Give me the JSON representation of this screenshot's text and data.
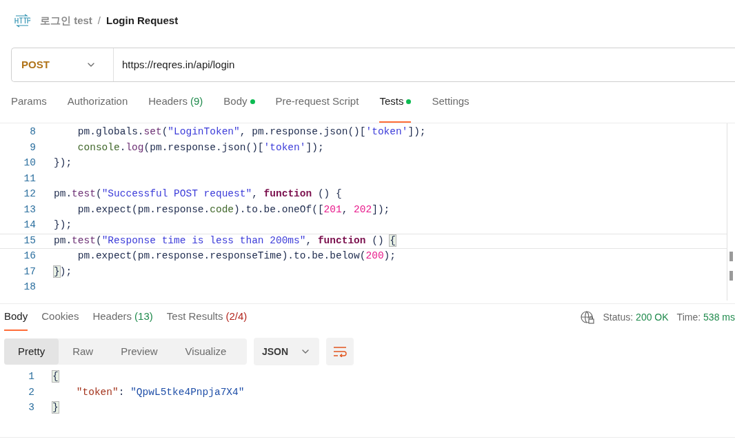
{
  "breadcrumb": {
    "collection": "로그인 test",
    "separator": "/",
    "request": "Login Request"
  },
  "request": {
    "method": "POST",
    "url": "https://reqres.in/api/login"
  },
  "request_tabs": [
    {
      "label": "Params",
      "selected": false
    },
    {
      "label": "Authorization",
      "selected": false
    },
    {
      "label": "Headers",
      "count": "(9)",
      "selected": false
    },
    {
      "label": "Body",
      "dot": true,
      "selected": false
    },
    {
      "label": "Pre-request Script",
      "selected": false
    },
    {
      "label": "Tests",
      "dot": true,
      "selected": true
    },
    {
      "label": "Settings",
      "selected": false
    }
  ],
  "editor": {
    "lines": [
      {
        "number": "8",
        "tokens": [
          {
            "text": "    pm.",
            "kind": "plain"
          },
          {
            "text": "globals",
            "kind": "plain"
          },
          {
            "text": ".",
            "kind": "plain"
          },
          {
            "text": "set",
            "kind": "method"
          },
          {
            "text": "(",
            "kind": "plain"
          },
          {
            "text": "\"LoginToken\"",
            "kind": "string"
          },
          {
            "text": ", pm.response.json()[",
            "kind": "plain"
          },
          {
            "text": "'token'",
            "kind": "string"
          },
          {
            "text": "]);",
            "kind": "plain"
          }
        ]
      },
      {
        "number": "9",
        "tokens": [
          {
            "text": "    console",
            "kind": "builtin"
          },
          {
            "text": ".",
            "kind": "plain"
          },
          {
            "text": "log",
            "kind": "method"
          },
          {
            "text": "(pm.response.json()[",
            "kind": "plain"
          },
          {
            "text": "'token'",
            "kind": "string"
          },
          {
            "text": "]);",
            "kind": "plain"
          }
        ]
      },
      {
        "number": "10",
        "tokens": [
          {
            "text": "}",
            "kind": "plain"
          },
          {
            "text": ");",
            "kind": "plain"
          }
        ]
      },
      {
        "number": "11"
      },
      {
        "number": "12",
        "tokens": [
          {
            "text": "pm.",
            "kind": "plain"
          },
          {
            "text": "test",
            "kind": "method"
          },
          {
            "text": "(",
            "kind": "plain"
          },
          {
            "text": "\"Successful POST request\"",
            "kind": "string"
          },
          {
            "text": ", ",
            "kind": "plain"
          },
          {
            "text": "function",
            "kind": "keyword"
          },
          {
            "text": " () {",
            "kind": "plain"
          }
        ]
      },
      {
        "number": "13",
        "tokens": [
          {
            "text": "    pm.expect(pm.response.",
            "kind": "plain"
          },
          {
            "text": "code",
            "kind": "builtin"
          },
          {
            "text": ").to.be.oneOf([",
            "kind": "plain"
          },
          {
            "text": "201",
            "kind": "number"
          },
          {
            "text": ", ",
            "kind": "plain"
          },
          {
            "text": "202",
            "kind": "number"
          },
          {
            "text": "]);",
            "kind": "plain"
          }
        ]
      },
      {
        "number": "14",
        "tokens": [
          {
            "text": "}",
            "kind": "plain"
          },
          {
            "text": ");",
            "kind": "plain"
          }
        ]
      },
      {
        "number": "15",
        "current": true,
        "tokens": [
          {
            "text": "pm.",
            "kind": "plain"
          },
          {
            "text": "test",
            "kind": "method"
          },
          {
            "text": "(",
            "kind": "plain"
          },
          {
            "text": "\"Response time is less than 200ms\"",
            "kind": "string"
          },
          {
            "text": ", ",
            "kind": "plain"
          },
          {
            "text": "function",
            "kind": "keyword"
          },
          {
            "text": " () ",
            "kind": "plain"
          },
          {
            "text": "{",
            "kind": "matched"
          }
        ]
      },
      {
        "number": "16",
        "tokens": [
          {
            "text": "    pm.expect(pm.response.responseTime).to.be.below(",
            "kind": "plain"
          },
          {
            "text": "200",
            "kind": "number"
          },
          {
            "text": ");",
            "kind": "plain"
          }
        ]
      },
      {
        "number": "17",
        "tokens": [
          {
            "text": "}",
            "kind": "matched"
          },
          {
            "text": ");",
            "kind": "plain"
          }
        ]
      },
      {
        "number": "18"
      }
    ]
  },
  "response_tabs": [
    {
      "label": "Body",
      "selected": true
    },
    {
      "label": "Cookies",
      "selected": false
    },
    {
      "label": "Headers",
      "count": "(13)",
      "color": "#1f8a4c",
      "selected": false
    },
    {
      "label": "Test Results",
      "count": "(2/4)",
      "color": "#b3261e",
      "selected": false
    }
  ],
  "status": {
    "status_label": "Status:",
    "status_value": "200 OK",
    "time_label": "Time:",
    "time_value": "538 ms"
  },
  "view_modes": [
    {
      "label": "Pretty",
      "selected": true
    },
    {
      "label": "Raw",
      "selected": false
    },
    {
      "label": "Preview",
      "selected": false
    },
    {
      "label": "Visualize",
      "selected": false
    }
  ],
  "format": "JSON",
  "response_body": {
    "lines": [
      {
        "number": "1",
        "tokens": [
          {
            "text": "{",
            "kind": "matched"
          }
        ]
      },
      {
        "number": "2",
        "tokens": [
          {
            "text": "    \"token\"",
            "kind": "key"
          },
          {
            "text": ": ",
            "kind": "plain"
          },
          {
            "text": "\"QpwL5tke4Pnpja7X4\"",
            "kind": "value"
          }
        ]
      },
      {
        "number": "3",
        "tokens": [
          {
            "text": "}",
            "kind": "matched"
          }
        ]
      }
    ]
  }
}
